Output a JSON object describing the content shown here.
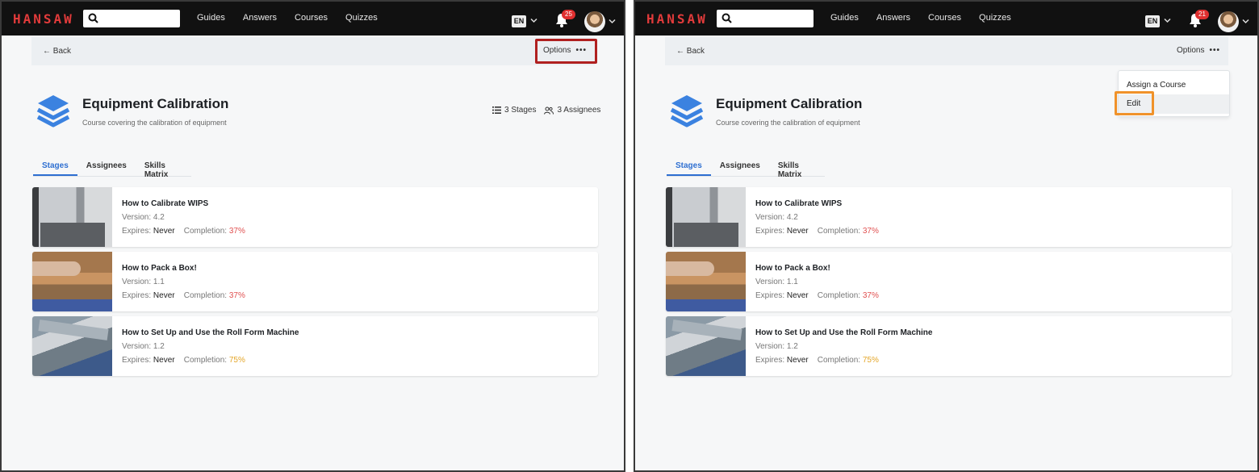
{
  "nav": {
    "logo": "HANSAW",
    "links": [
      "Guides",
      "Answers",
      "Courses",
      "Quizzes"
    ],
    "language": "EN",
    "badge_left": "25",
    "badge_right": "21"
  },
  "subheader": {
    "back_label": "← Back",
    "options_label": "Options",
    "options_dots": "•••"
  },
  "course": {
    "title": "Equipment Calibration",
    "description": "Course covering the calibration of equipment",
    "stages_stat": "3 Stages",
    "assignees_stat": "3 Assignees"
  },
  "tabs": [
    "Stages",
    "Assignees",
    "Skills Matrix"
  ],
  "stages": [
    {
      "title": "How to Calibrate WIPS",
      "version": "Version: 4.2",
      "expires_label": "Expires:",
      "expires_value": "Never",
      "completion_label": "Completion:",
      "completion_value": "37%"
    },
    {
      "title": "How to Pack a Box!",
      "version": "Version: 1.1",
      "expires_label": "Expires:",
      "expires_value": "Never",
      "completion_label": "Completion:",
      "completion_value": "37%"
    },
    {
      "title": "How to Set Up and Use the Roll Form Machine",
      "version": "Version: 1.2",
      "expires_label": "Expires:",
      "expires_value": "Never",
      "completion_label": "Completion:",
      "completion_value": "75%"
    }
  ],
  "dropdown": {
    "items": [
      "Assign a Course",
      "Edit"
    ]
  },
  "colors": {
    "accent": "#2e6fd1",
    "logo": "#e23b3b",
    "completion_low": "#e05050",
    "completion_mid": "#e4a628",
    "highlight_red": "#b02020",
    "highlight_orange": "#f0922a"
  },
  "icons": {
    "search": "search-icon",
    "bell": "bell-icon",
    "course": "layers-icon",
    "stages": "list-icon",
    "assignees": "users-icon"
  }
}
